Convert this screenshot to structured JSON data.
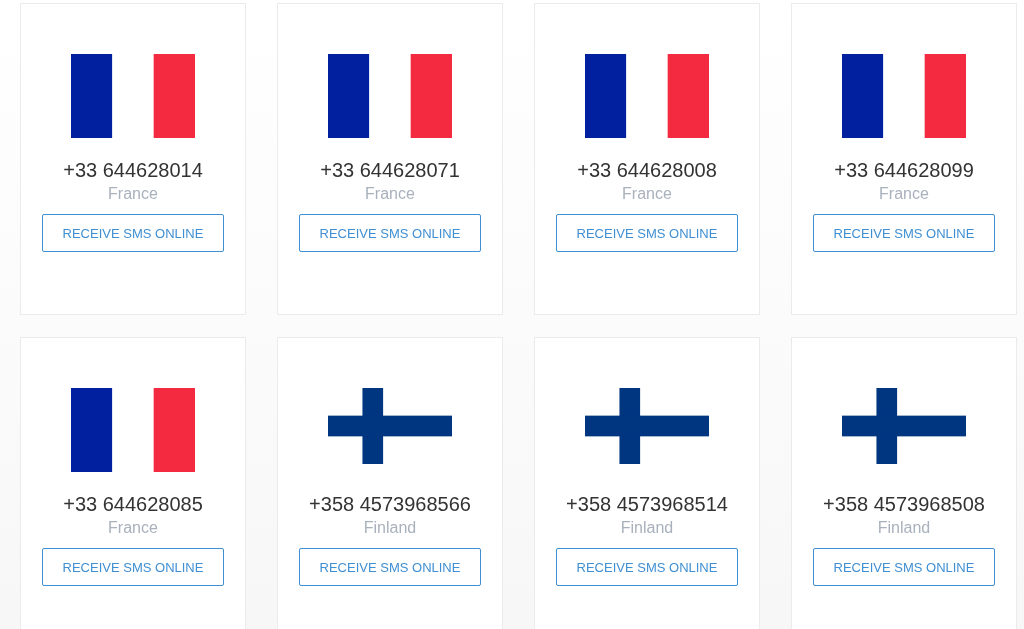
{
  "cards": [
    {
      "kind": "france",
      "phone": "+33 644628014",
      "country": "France",
      "button": "RECEIVE SMS ONLINE"
    },
    {
      "kind": "france",
      "phone": "+33 644628071",
      "country": "France",
      "button": "RECEIVE SMS ONLINE"
    },
    {
      "kind": "france",
      "phone": "+33 644628008",
      "country": "France",
      "button": "RECEIVE SMS ONLINE"
    },
    {
      "kind": "france",
      "phone": "+33 644628099",
      "country": "France",
      "button": "RECEIVE SMS ONLINE"
    },
    {
      "kind": "france",
      "phone": "+33 644628085",
      "country": "France",
      "button": "RECEIVE SMS ONLINE"
    },
    {
      "kind": "finland",
      "phone": "+358 4573968566",
      "country": "Finland",
      "button": "RECEIVE SMS ONLINE"
    },
    {
      "kind": "finland",
      "phone": "+358 4573968514",
      "country": "Finland",
      "button": "RECEIVE SMS ONLINE"
    },
    {
      "kind": "finland",
      "phone": "+358 4573968508",
      "country": "Finland",
      "button": "RECEIVE SMS ONLINE"
    }
  ]
}
